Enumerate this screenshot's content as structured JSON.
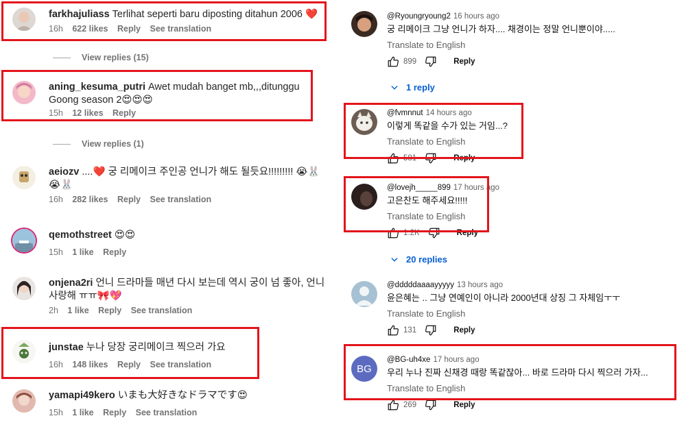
{
  "instagram": {
    "comments": [
      {
        "user": "farkhajuliass",
        "text": "Terlihat seperti baru diposting ditahun 2006 ❤️",
        "time": "16h",
        "likes": "622 likes",
        "reply": "Reply",
        "translate": "See translation"
      },
      {
        "user": "aning_kesuma_putri",
        "text": "Awet mudah banget mb,,,ditunggu Goong season 2😍😍😍",
        "time": "15h",
        "likes": "12 likes",
        "reply": "Reply",
        "translate": ""
      },
      {
        "user": "aeiozv",
        "text": "....❤️ 궁 리메이크 주인공 언니가 해도 될듯요!!!!!!!!! 😭🐰😭🐰",
        "time": "16h",
        "likes": "282 likes",
        "reply": "Reply",
        "translate": "See translation"
      },
      {
        "user": "qemothstreet",
        "text": "😍😍",
        "time": "15h",
        "likes": "1 like",
        "reply": "Reply",
        "translate": ""
      },
      {
        "user": "onjena2ri",
        "text": "언니 드라마들 매년 다시 보는데 역시 궁이 넘 좋아, 언니 사랑해 ㅠㅠ🎀💖",
        "time": "2h",
        "likes": "1 like",
        "reply": "Reply",
        "translate": "See translation"
      },
      {
        "user": "junstae",
        "text": "누나 당장 궁리메이크 찍으러 가요",
        "time": "16h",
        "likes": "148 likes",
        "reply": "Reply",
        "translate": "See translation"
      },
      {
        "user": "yamapi49kero",
        "text": "いまも大好きなドラマです😍",
        "time": "15h",
        "likes": "1 like",
        "reply": "Reply",
        "translate": "See translation"
      }
    ],
    "view_replies_1": "View replies (15)",
    "view_replies_2": "View replies (1)"
  },
  "youtube": {
    "comments": [
      {
        "handle": "@Ryoungryoung2",
        "time": "16 hours ago",
        "text": "궁 리메이크 그냥 언니가 하자.... 채경이는 정말 언니뿐이야.....",
        "translate": "Translate to English",
        "likes": "899",
        "reply": "Reply"
      },
      {
        "handle": "@fvmnnut",
        "time": "14 hours ago",
        "text": "이렇게 똑같을 수가 있는 거임...?",
        "translate": "Translate to English",
        "likes": "581",
        "reply": "Reply"
      },
      {
        "handle": "@lovejh_____899",
        "time": "17 hours ago",
        "text": "고은찬도 해주세요!!!!!",
        "translate": "Translate to English",
        "likes": "1.2K",
        "reply": "Reply"
      },
      {
        "handle": "@dddddaaaayyyyy",
        "time": "13 hours ago",
        "text": "윤은혜는 .. 그냥 연예인이 아니라 2000년대 상징 그 자체임ㅜㅜ",
        "translate": "Translate to English",
        "likes": "131",
        "reply": "Reply"
      },
      {
        "handle": "@BG-uh4xe",
        "time": "17 hours ago",
        "text": "우리 누나 진짜 신채경 때랑 똑같잖아... 바로 드라마 다시 찍으러 가자...",
        "translate": "Translate to English",
        "likes": "269",
        "reply": "Reply",
        "avatar_letters": "BG"
      }
    ],
    "replies_1": "1 reply",
    "replies_2": "20 replies"
  },
  "colors": {
    "highlight": "#e3141b",
    "link_blue": "#065fd4",
    "meta_gray": "#737373"
  }
}
